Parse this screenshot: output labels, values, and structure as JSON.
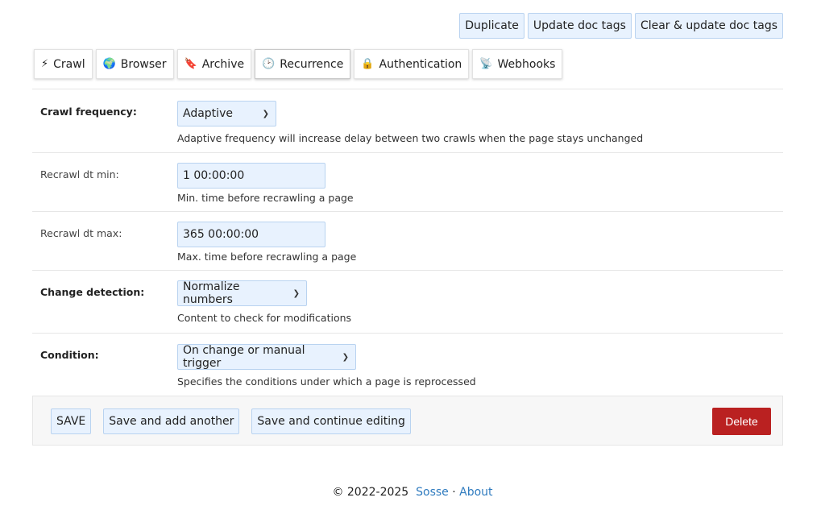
{
  "top_actions": {
    "duplicate": "Duplicate",
    "update_tags": "Update doc tags",
    "clear_update_tags": "Clear & update doc tags"
  },
  "tabs": [
    {
      "icon": "⚡",
      "label": "Crawl"
    },
    {
      "icon": "🌍",
      "label": "Browser"
    },
    {
      "icon": "🔖",
      "label": "Archive"
    },
    {
      "icon": "🕑",
      "label": "Recurrence"
    },
    {
      "icon": "🔒",
      "label": "Authentication"
    },
    {
      "icon": "📡",
      "label": "Webhooks"
    }
  ],
  "active_tab": "Recurrence",
  "form": {
    "crawl_frequency": {
      "label": "Crawl frequency:",
      "value": "Adaptive",
      "help": "Adaptive frequency will increase delay between two crawls when the page stays unchanged"
    },
    "recrawl_dt_min": {
      "label": "Recrawl dt min:",
      "value": "1 00:00:00",
      "help": "Min. time before recrawling a page"
    },
    "recrawl_dt_max": {
      "label": "Recrawl dt max:",
      "value": "365 00:00:00",
      "help": "Max. time before recrawling a page"
    },
    "change_detection": {
      "label": "Change detection:",
      "value": "Normalize numbers",
      "help": "Content to check for modifications"
    },
    "condition": {
      "label": "Condition:",
      "value": "On change or manual trigger",
      "help": "Specifies the conditions under which a page is reprocessed"
    }
  },
  "actions": {
    "save": "SAVE",
    "save_add": "Save and add another",
    "save_continue": "Save and continue editing",
    "delete": "Delete"
  },
  "footer": {
    "copyright": "© 2022-2025",
    "sosse": "Sosse",
    "separator": "·",
    "about": "About"
  },
  "colors": {
    "button_bg": "#e8f2fe",
    "delete_bg": "#ba2121",
    "link": "#2f7bbf"
  }
}
